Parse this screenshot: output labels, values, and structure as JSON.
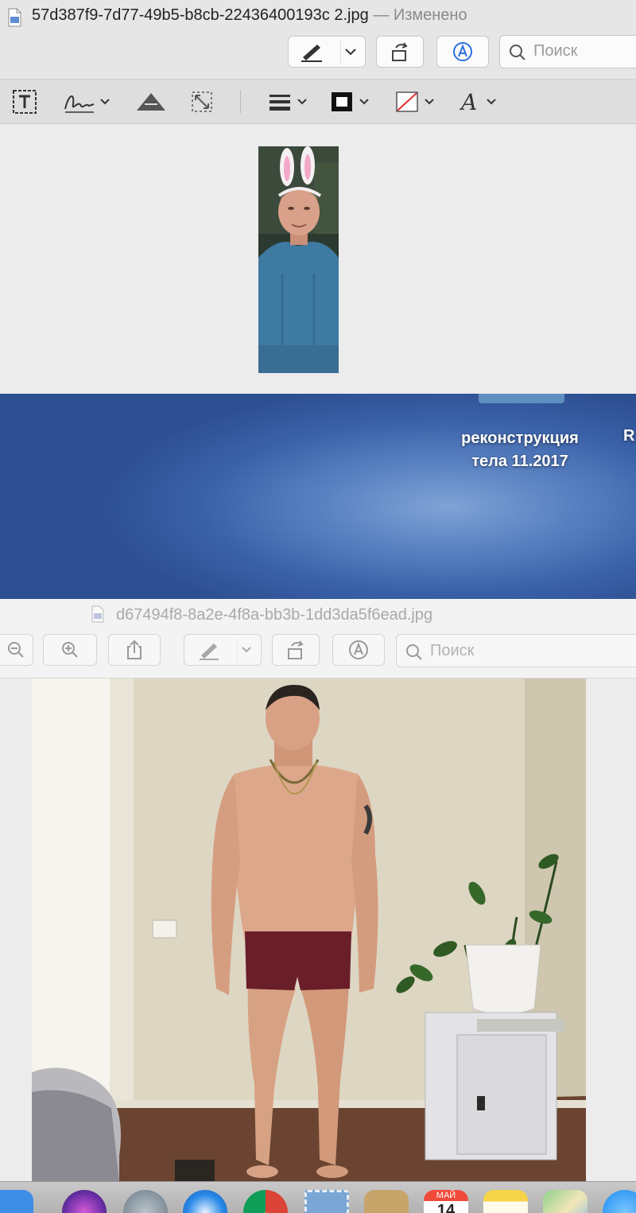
{
  "window1": {
    "filename": "57d387f9-7d77-49b5-b8cb-22436400193c 2.jpg",
    "separator": "—",
    "status": "Изменено",
    "search_placeholder": "Поиск",
    "toolbar_icons": [
      "markup-pen-icon",
      "chevron-down-icon",
      "rotate-icon",
      "annotate-circle-icon",
      "search-icon"
    ],
    "markup_icons": [
      "text-box-icon",
      "signature-icon",
      "adjust-color-icon",
      "resize-icon",
      "line-style-icon",
      "border-color-icon",
      "fill-color-icon",
      "text-style-icon"
    ]
  },
  "desktop": {
    "folder_label_line1": "реконструкция",
    "folder_label_line2": "тела 11.2017",
    "partial_label": "R"
  },
  "window2": {
    "filename": "d67494f8-8a2e-4f8a-bb3b-1dd3da5f6ead.jpg",
    "search_placeholder": "Поиск",
    "toolbar_icons": [
      "zoom-out-icon",
      "zoom-in-icon",
      "share-icon",
      "markup-pen-icon",
      "chevron-down-icon",
      "rotate-icon",
      "annotate-circle-icon",
      "search-icon"
    ]
  },
  "dock": {
    "apps": [
      "finder-icon",
      "siri-icon",
      "launchpad-icon",
      "safari-icon",
      "chrome-icon",
      "mail-icon",
      "contacts-icon",
      "calendar-icon",
      "notes-icon",
      "maps-icon",
      "app-store-icon"
    ],
    "calendar_month": "МАЙ",
    "calendar_day": "14"
  },
  "colors": {
    "desktop_blue": "#3a61a8",
    "accent_blue": "#2a6fe0"
  }
}
